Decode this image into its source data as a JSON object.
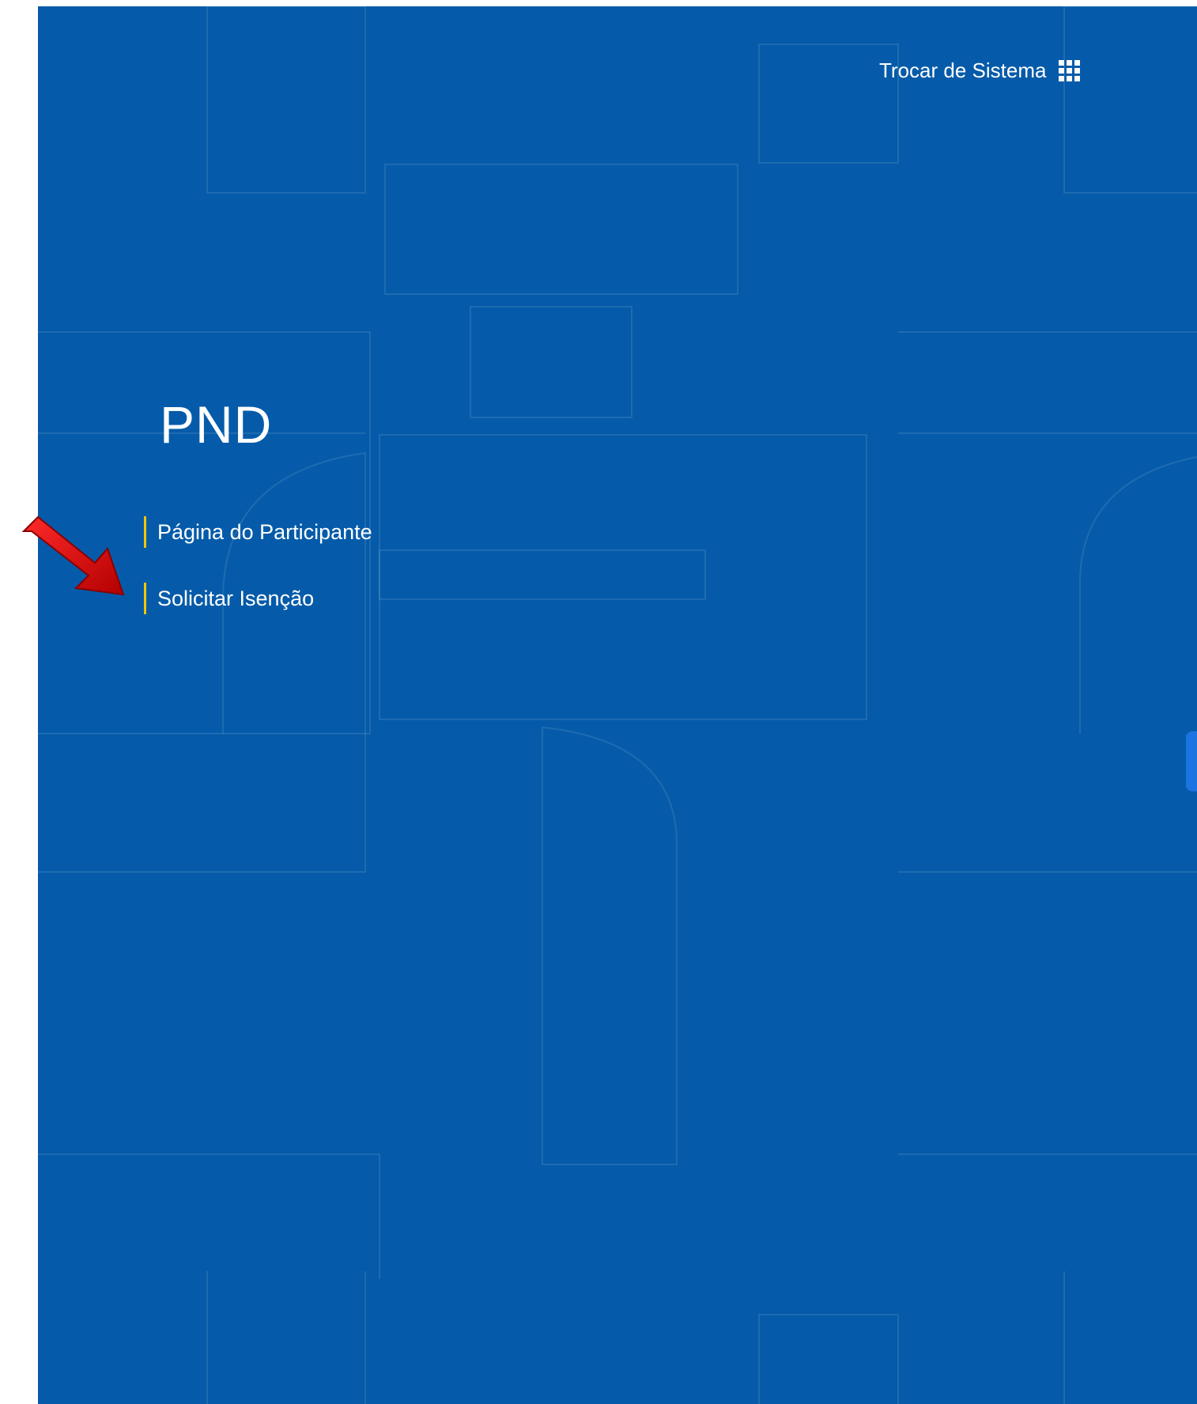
{
  "header": {
    "switch_system_label": "Trocar de Sistema",
    "switch_system_icon": "grid-icon"
  },
  "system": {
    "title": "PND"
  },
  "nav": {
    "items": [
      {
        "label": "Página do Participante"
      },
      {
        "label": "Solicitar Isenção"
      }
    ]
  },
  "accessibility": {
    "libras_icon": "sign-language-hands-icon"
  },
  "colors": {
    "background": "#055ba9",
    "accent_bar": "#f2c500",
    "arrow": "#d8000c",
    "libras_button": "#1b74e0"
  }
}
